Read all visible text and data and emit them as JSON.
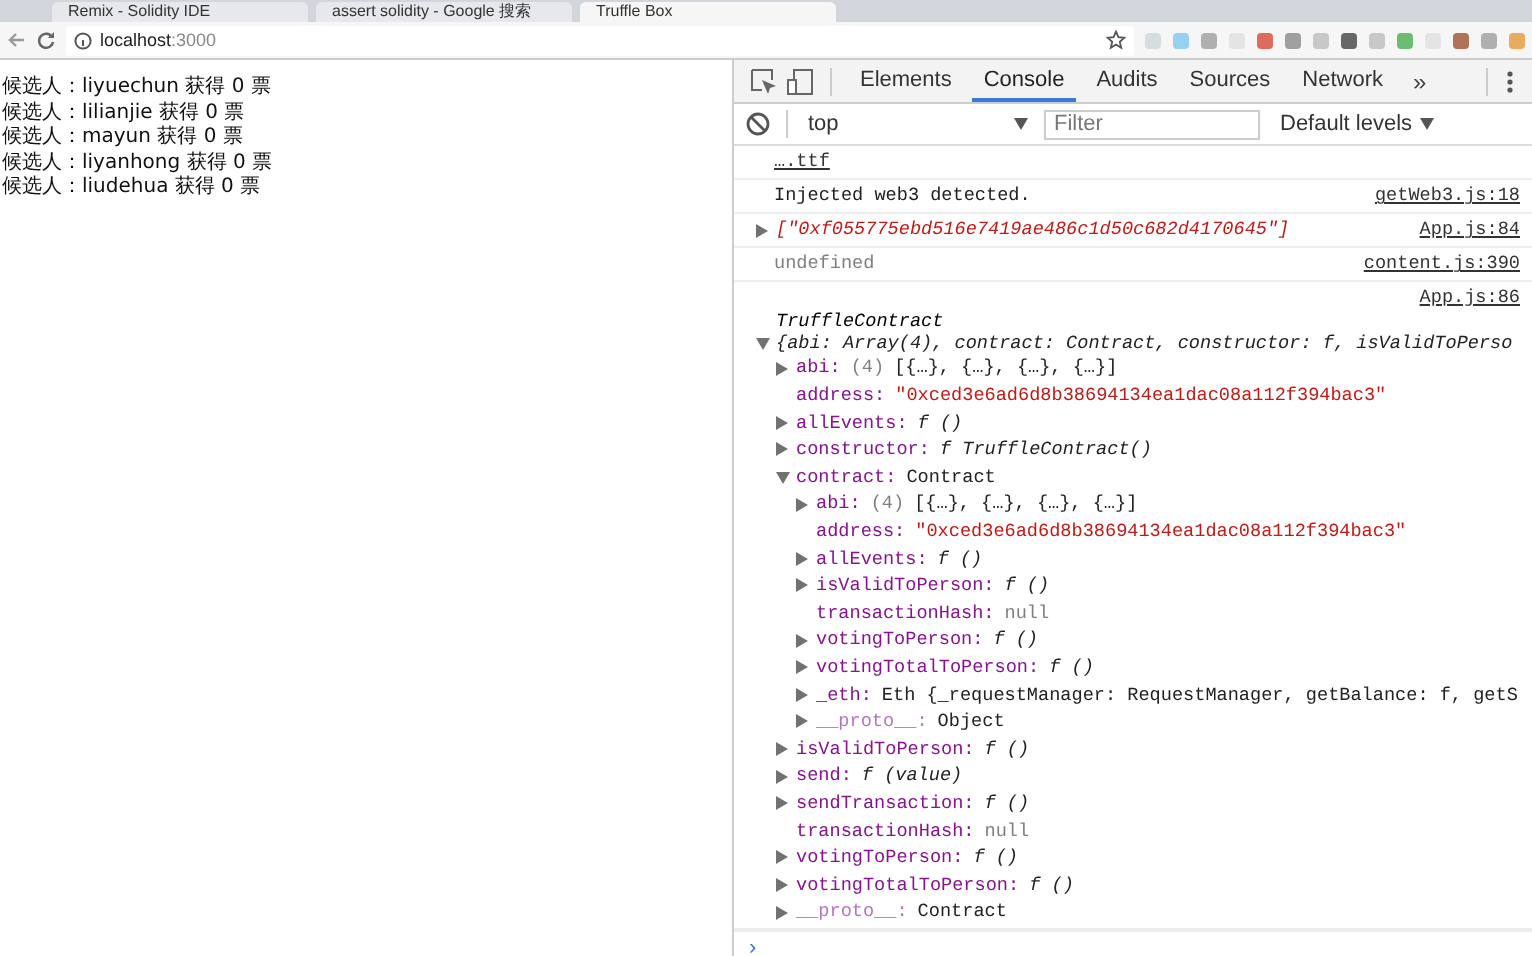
{
  "browser": {
    "tabs": [
      {
        "title": "Remix - Solidity IDE",
        "selected": false
      },
      {
        "title": "assert solidity - Google 搜索",
        "selected": false
      },
      {
        "title": "Truffle Box",
        "selected": true
      }
    ],
    "address": {
      "host": "localhost",
      "port": ":3000"
    }
  },
  "page": {
    "lines": [
      "候选人：liyuechun 获得 0 票",
      "候选人：lilianjie 获得 0 票",
      "候选人：mayun 获得 0 票",
      "候选人：liyanhong 获得 0 票",
      "候选人：liudehua 获得 0 票"
    ]
  },
  "devtools": {
    "tabs": [
      {
        "label": "Elements",
        "selected": false
      },
      {
        "label": "Console",
        "selected": true
      },
      {
        "label": "Audits",
        "selected": false
      },
      {
        "label": "Sources",
        "selected": false
      },
      {
        "label": "Network",
        "selected": false
      }
    ],
    "more": "»",
    "context": "top",
    "filter_placeholder": "Filter",
    "levels": "Default levels"
  },
  "console": {
    "messages": [
      {
        "kind": "link",
        "text": "….ttf"
      },
      {
        "kind": "log",
        "text": "Injected web3 detected.",
        "source": "getWeb3.js:18"
      },
      {
        "kind": "array",
        "text": "[\"0xf055775ebd516e7419ae486c1d50c682d4170645\"]",
        "source": "App.js:84",
        "expanded": false
      },
      {
        "kind": "undefined",
        "text": "undefined",
        "source": "content.js:390"
      },
      {
        "kind": "object",
        "source": "App.js:86",
        "title": "TruffleContract",
        "summary": "{abi: Array(4), contract: Contract, constructor: f, isValidToPerso",
        "expanded": true,
        "children": [
          {
            "key": "abi:",
            "count": "(4)",
            "value": "[{…}, {…}, {…}, {…}]",
            "kind": "array",
            "expanded": false,
            "faded": false
          },
          {
            "key": "address:",
            "value": "\"0xced3e6ad6d8b38694134ea1dac08a112f394bac3\"",
            "kind": "string",
            "faded": false
          },
          {
            "key": "allEvents:",
            "value": "f ()",
            "kind": "function",
            "expanded": false,
            "faded": false
          },
          {
            "key": "constructor:",
            "value": "f TruffleContract()",
            "kind": "function",
            "expanded": false,
            "faded": false
          },
          {
            "key": "contract:",
            "value": "Contract",
            "kind": "object",
            "expanded": true,
            "faded": false,
            "children": [
              {
                "key": "abi:",
                "count": "(4)",
                "value": "[{…}, {…}, {…}, {…}]",
                "kind": "array",
                "expanded": false,
                "faded": false
              },
              {
                "key": "address:",
                "value": "\"0xced3e6ad6d8b38694134ea1dac08a112f394bac3\"",
                "kind": "string",
                "faded": false
              },
              {
                "key": "allEvents:",
                "value": "f ()",
                "kind": "function",
                "expanded": false,
                "faded": false
              },
              {
                "key": "isValidToPerson:",
                "value": "f ()",
                "kind": "function",
                "expanded": false,
                "faded": false
              },
              {
                "key": "transactionHash:",
                "value": "null",
                "kind": "null",
                "faded": false
              },
              {
                "key": "votingToPerson:",
                "value": "f ()",
                "kind": "function",
                "expanded": false,
                "faded": false
              },
              {
                "key": "votingTotalToPerson:",
                "value": "f ()",
                "kind": "function",
                "expanded": false,
                "faded": false
              },
              {
                "key": "_eth:",
                "value": "Eth {_requestManager: RequestManager, getBalance: f, getS",
                "kind": "object",
                "expanded": false,
                "faded": false
              },
              {
                "key": "__proto__:",
                "value": "Object",
                "kind": "object",
                "expanded": false,
                "faded": true
              }
            ]
          },
          {
            "key": "isValidToPerson:",
            "value": "f ()",
            "kind": "function",
            "expanded": false,
            "faded": false
          },
          {
            "key": "send:",
            "value": "f (value)",
            "kind": "function",
            "expanded": false,
            "faded": false
          },
          {
            "key": "sendTransaction:",
            "value": "f ()",
            "kind": "function",
            "expanded": false,
            "faded": false
          },
          {
            "key": "transactionHash:",
            "value": "null",
            "kind": "null",
            "faded": false
          },
          {
            "key": "votingToPerson:",
            "value": "f ()",
            "kind": "function",
            "expanded": false,
            "faded": false
          },
          {
            "key": "votingTotalToPerson:",
            "value": "f ()",
            "kind": "function",
            "expanded": false,
            "faded": false
          },
          {
            "key": "__proto__:",
            "value": "Contract",
            "kind": "object",
            "expanded": false,
            "faded": true
          }
        ]
      }
    ],
    "prompt": "›"
  }
}
